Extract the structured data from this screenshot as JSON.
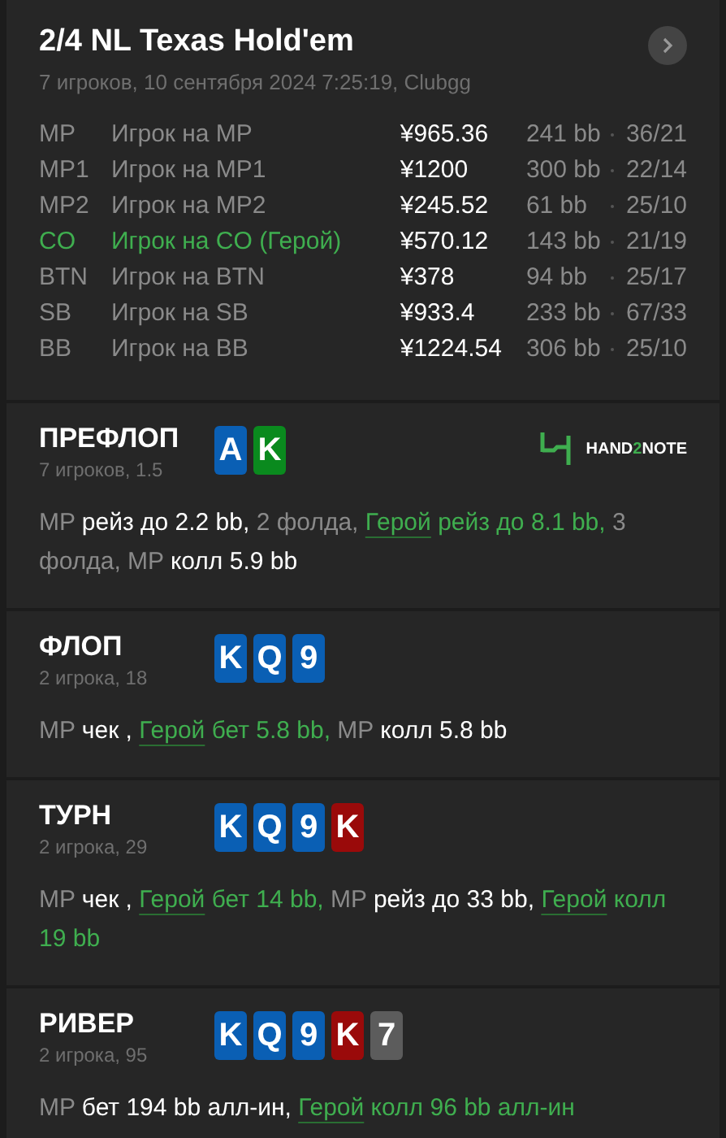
{
  "header": {
    "title": "2/4 NL Texas Hold'em",
    "subtitle": "7 игроков, 10 сентября 2024 7:25:19, Clubgg"
  },
  "players": [
    {
      "position": "MP",
      "name": "Игрок на MP",
      "stack": "¥965.36",
      "bb": "241 bb",
      "stats": "36/21",
      "hero": false
    },
    {
      "position": "MP1",
      "name": "Игрок на MP1",
      "stack": "¥1200",
      "bb": "300 bb",
      "stats": "22/14",
      "hero": false
    },
    {
      "position": "MP2",
      "name": "Игрок на MP2",
      "stack": "¥245.52",
      "bb": "61 bb",
      "stats": "25/10",
      "hero": false
    },
    {
      "position": "CO",
      "name": "Игрок на CO (Герой)",
      "stack": "¥570.12",
      "bb": "143 bb",
      "stats": "21/19",
      "hero": true
    },
    {
      "position": "BTN",
      "name": "Игрок на BTN",
      "stack": "¥378",
      "bb": "94 bb",
      "stats": "25/17",
      "hero": false
    },
    {
      "position": "SB",
      "name": "Игрок на SB",
      "stack": "¥933.4",
      "bb": "233 bb",
      "stats": "67/33",
      "hero": false
    },
    {
      "position": "BB",
      "name": "Игрок на BB",
      "stack": "¥1224.54",
      "bb": "306 bb",
      "stats": "25/10",
      "hero": false
    }
  ],
  "logo": {
    "text_1": "HAND",
    "text_2": "2",
    "text_3": "NOTE"
  },
  "streets": [
    {
      "title": "ПРЕФЛОП",
      "subtitle": "7 игроков, 1.5",
      "cards": [
        {
          "rank": "A",
          "color": "#0a5fb4"
        },
        {
          "rank": "K",
          "color": "#0a8a1e"
        }
      ],
      "actions": [
        {
          "kind": "pos",
          "text": "MP "
        },
        {
          "kind": "act",
          "text": "рейз до 2.2 bb,"
        },
        {
          "kind": "pos",
          "text": " 2 фолда, "
        },
        {
          "kind": "hero",
          "text": "Герой"
        },
        {
          "kind": "herotext",
          "text": " рейз до 8.1 bb,"
        },
        {
          "kind": "pos",
          "text": " 3 фолда, MP "
        },
        {
          "kind": "act",
          "text": "колл 5.9 bb"
        }
      ]
    },
    {
      "title": "ФЛОП",
      "subtitle": "2 игрока, 18",
      "cards": [
        {
          "rank": "K",
          "color": "#0a5fb4"
        },
        {
          "rank": "Q",
          "color": "#0a5fb4"
        },
        {
          "rank": "9",
          "color": "#0a5fb4"
        }
      ],
      "actions": [
        {
          "kind": "pos",
          "text": "MP "
        },
        {
          "kind": "act",
          "text": "чек , "
        },
        {
          "kind": "hero",
          "text": "Герой"
        },
        {
          "kind": "herotext",
          "text": " бет 5.8 bb,"
        },
        {
          "kind": "pos",
          "text": " MP "
        },
        {
          "kind": "act",
          "text": "колл 5.8 bb"
        }
      ]
    },
    {
      "title": "ТУРН",
      "subtitle": "2 игрока, 29",
      "cards": [
        {
          "rank": "K",
          "color": "#0a5fb4"
        },
        {
          "rank": "Q",
          "color": "#0a5fb4"
        },
        {
          "rank": "9",
          "color": "#0a5fb4"
        },
        {
          "rank": "K",
          "color": "#9a0a0a"
        }
      ],
      "actions": [
        {
          "kind": "pos",
          "text": "MP "
        },
        {
          "kind": "act",
          "text": "чек , "
        },
        {
          "kind": "hero",
          "text": "Герой"
        },
        {
          "kind": "herotext",
          "text": " бет 14 bb,"
        },
        {
          "kind": "pos",
          "text": " MP "
        },
        {
          "kind": "act",
          "text": "рейз до 33 bb, "
        },
        {
          "kind": "hero",
          "text": "Герой"
        },
        {
          "kind": "herotext",
          "text": " колл 19 bb"
        }
      ]
    },
    {
      "title": "РИВЕР",
      "subtitle": "2 игрока, 95",
      "cards": [
        {
          "rank": "K",
          "color": "#0a5fb4"
        },
        {
          "rank": "Q",
          "color": "#0a5fb4"
        },
        {
          "rank": "9",
          "color": "#0a5fb4"
        },
        {
          "rank": "K",
          "color": "#9a0a0a"
        },
        {
          "rank": "7",
          "color": "#5c5c5c"
        }
      ],
      "actions": [
        {
          "kind": "pos",
          "text": "MP "
        },
        {
          "kind": "act",
          "text": "бет 194 bb алл-ин, "
        },
        {
          "kind": "hero",
          "text": "Герой"
        },
        {
          "kind": "herotext",
          "text": " колл 96 bb алл-ин"
        }
      ]
    }
  ]
}
